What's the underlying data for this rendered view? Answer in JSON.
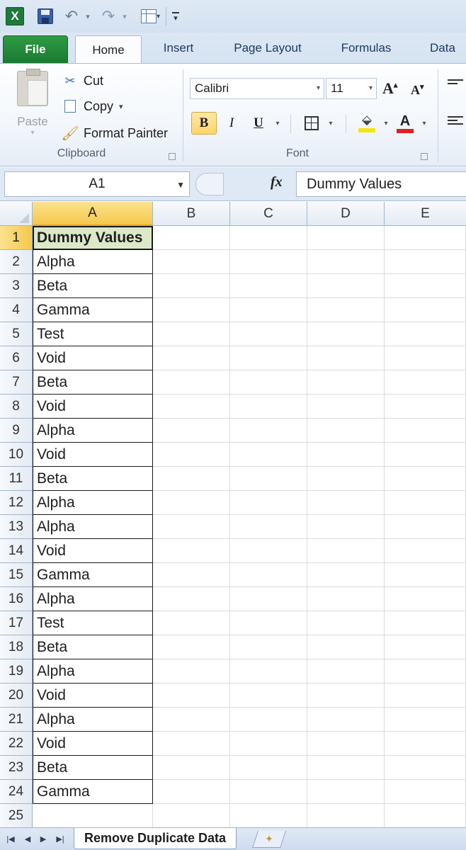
{
  "app": {
    "logo_letter": "X"
  },
  "qat": {
    "undo": "↶",
    "redo": "↷",
    "dropdown": "▾"
  },
  "tabs": [
    {
      "label": "File"
    },
    {
      "label": "Home"
    },
    {
      "label": "Insert"
    },
    {
      "label": "Page Layout"
    },
    {
      "label": "Formulas"
    },
    {
      "label": "Data"
    }
  ],
  "clipboard": {
    "paste_label": "Paste",
    "cut_label": "Cut",
    "copy_label": "Copy",
    "format_painter_label": "Format Painter",
    "group_label": "Clipboard"
  },
  "font": {
    "name": "Calibri",
    "size": "11",
    "bold": "B",
    "italic": "I",
    "underline": "U",
    "font_color_letter": "A",
    "group_label": "Font",
    "grow": "A",
    "shrink": "A",
    "fill_color": "#f6e50a",
    "font_color": "#e21f1f"
  },
  "formula_bar": {
    "name_box": "A1",
    "fx": "fx",
    "content": "Dummy Values"
  },
  "columns": [
    "A",
    "B",
    "C",
    "D",
    "E"
  ],
  "rows": [
    {
      "num": "1",
      "a": "Dummy Values"
    },
    {
      "num": "2",
      "a": "Alpha"
    },
    {
      "num": "3",
      "a": "Beta"
    },
    {
      "num": "4",
      "a": "Gamma"
    },
    {
      "num": "5",
      "a": "Test"
    },
    {
      "num": "6",
      "a": "Void"
    },
    {
      "num": "7",
      "a": "Beta"
    },
    {
      "num": "8",
      "a": "Void"
    },
    {
      "num": "9",
      "a": "Alpha"
    },
    {
      "num": "10",
      "a": "Void"
    },
    {
      "num": "11",
      "a": "Beta"
    },
    {
      "num": "12",
      "a": "Alpha"
    },
    {
      "num": "13",
      "a": "Alpha"
    },
    {
      "num": "14",
      "a": "Void"
    },
    {
      "num": "15",
      "a": "Gamma"
    },
    {
      "num": "16",
      "a": "Alpha"
    },
    {
      "num": "17",
      "a": "Test"
    },
    {
      "num": "18",
      "a": "Beta"
    },
    {
      "num": "19",
      "a": "Alpha"
    },
    {
      "num": "20",
      "a": "Void"
    },
    {
      "num": "21",
      "a": "Alpha"
    },
    {
      "num": "22",
      "a": "Void"
    },
    {
      "num": "23",
      "a": "Beta"
    },
    {
      "num": "24",
      "a": "Gamma"
    },
    {
      "num": "25",
      "a": ""
    }
  ],
  "sheet_tabs": [
    {
      "label": "Remove Duplicate Data"
    }
  ],
  "colors": {
    "accent_green": "#1a7a30",
    "selected_header": "#f5c84b",
    "header_cell_fill": "#dde8c9"
  }
}
